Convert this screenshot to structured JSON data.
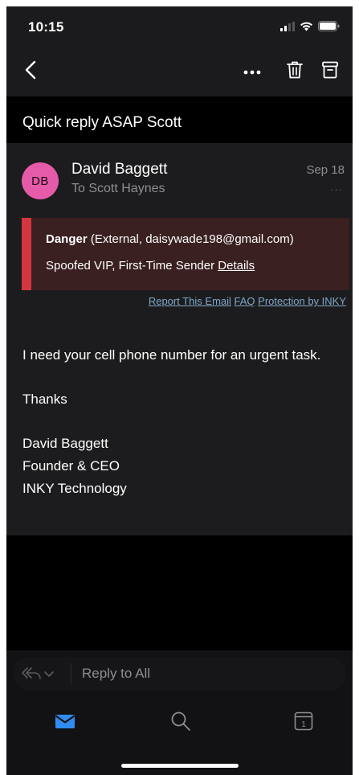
{
  "status_bar": {
    "time": "10:15"
  },
  "toolbar": {
    "back_icon": "chevron-left-icon",
    "more_icon": "ellipsis-icon",
    "delete_icon": "trash-icon",
    "archive_icon": "archive-icon"
  },
  "email": {
    "subject": "Quick reply ASAP Scott",
    "avatar_initials": "DB",
    "avatar_color": "#e55aa9",
    "sender": "David Baggett",
    "recipient": "To Scott Haynes",
    "date": "Sep 18",
    "more": "···",
    "warning": {
      "level": "Danger",
      "detail": " (External, daisywade198@gmail.com)",
      "line2": "Spoofed VIP, First-Time Sender ",
      "details_link": "Details",
      "stripe_color": "#d4363f"
    },
    "links": {
      "report": "Report This Email",
      "faq": "FAQ",
      "protection": "Protection by INKY"
    },
    "body": {
      "line1": "I need your cell phone number for an urgent task.",
      "line2": "Thanks",
      "signature": [
        "David Baggett",
        "Founder & CEO",
        "INKY Technology"
      ]
    }
  },
  "reply": {
    "placeholder": "Reply to All"
  },
  "tabs": {
    "calendar_day": "1"
  },
  "colors": {
    "accent": "#2f8cf0"
  }
}
